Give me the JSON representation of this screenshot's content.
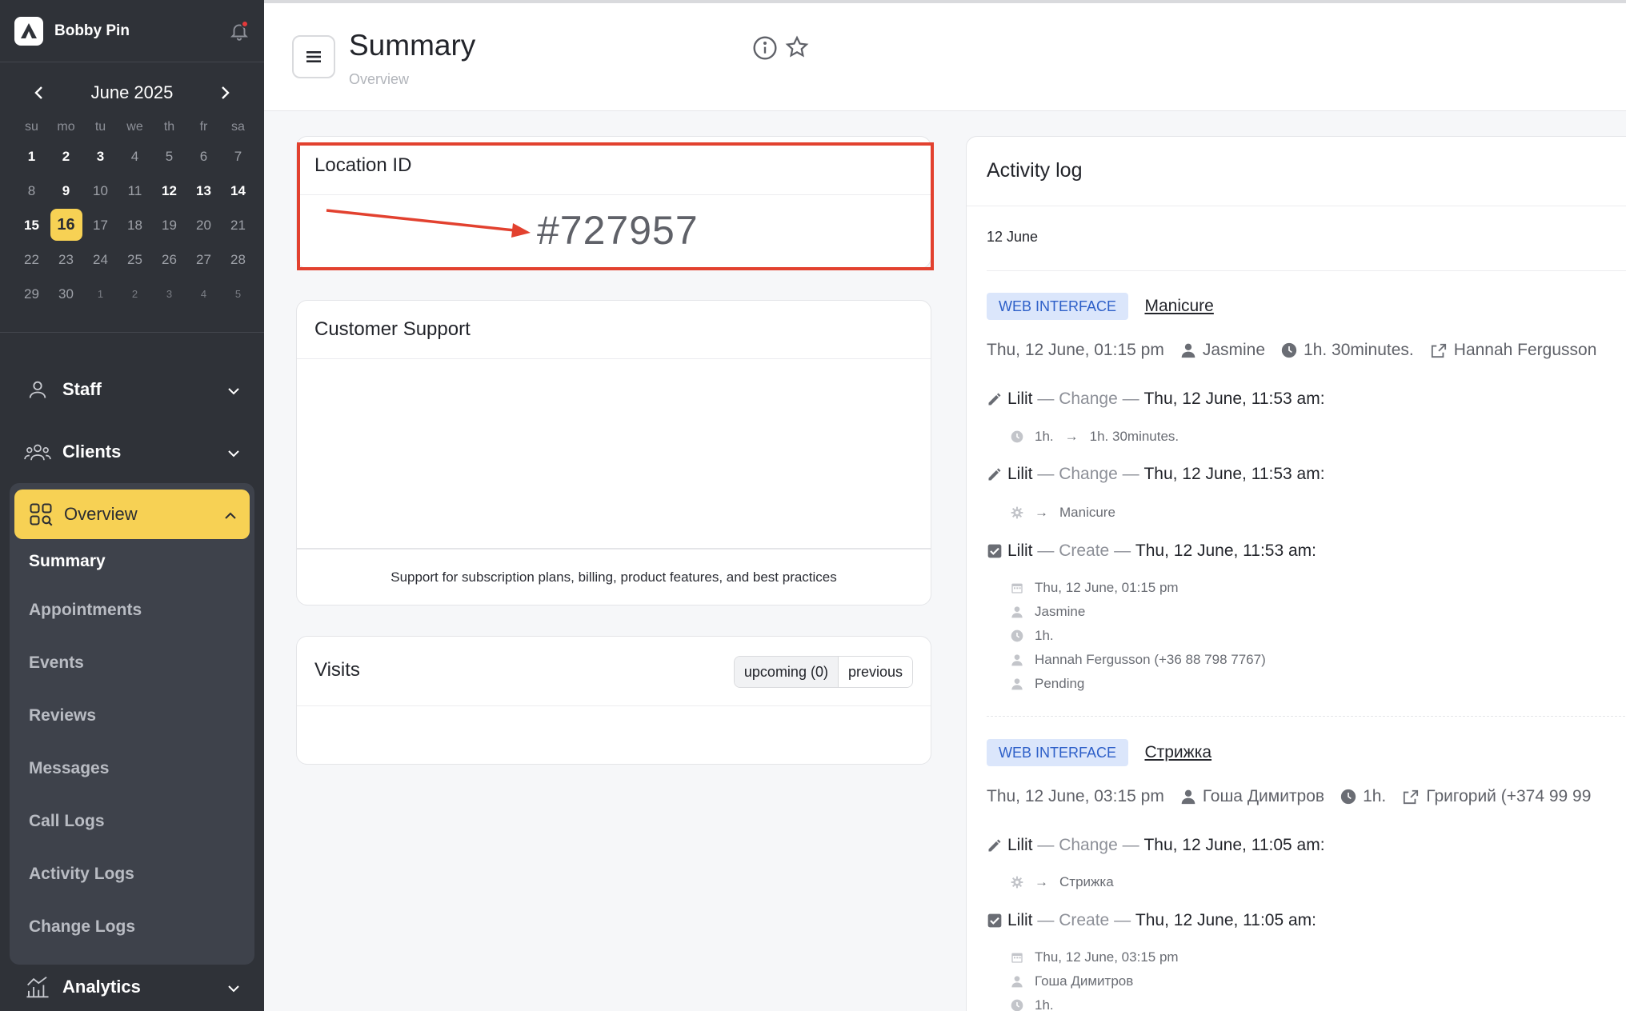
{
  "sidebar": {
    "user_name": "Bobby Pin",
    "calendar": {
      "title": "June 2025",
      "weekdays": [
        "su",
        "mo",
        "tu",
        "we",
        "th",
        "fr",
        "sa"
      ],
      "days": [
        [
          "1",
          "2",
          "3",
          "4",
          "5",
          "6",
          "7"
        ],
        [
          "8",
          "9",
          "10",
          "11",
          "12",
          "13",
          "14"
        ],
        [
          "15",
          "16",
          "17",
          "18",
          "19",
          "20",
          "21"
        ],
        [
          "22",
          "23",
          "24",
          "25",
          "26",
          "27",
          "28"
        ],
        [
          "29",
          "30",
          "1",
          "2",
          "3",
          "4",
          "5"
        ]
      ]
    },
    "nav": {
      "staff": "Staff",
      "clients": "Clients",
      "overview": "Overview",
      "analytics": "Analytics"
    },
    "overview_items": [
      "Summary",
      "Appointments",
      "Events",
      "Reviews",
      "Messages",
      "Call Logs",
      "Activity Logs",
      "Change Logs"
    ]
  },
  "header": {
    "title": "Summary",
    "subtitle": "Overview"
  },
  "location_card": {
    "title": "Location ID",
    "value": "#727957"
  },
  "support_card": {
    "title": "Customer Support",
    "description": "Support for subscription plans, billing, product features, and best practices"
  },
  "visits_card": {
    "title": "Visits",
    "tab_upcoming": "upcoming (0)",
    "tab_previous": "previous"
  },
  "activity_log": {
    "title": "Activity log",
    "date_group": "12 June",
    "entries": [
      {
        "source": "WEB INTERFACE",
        "service": "Manicure",
        "datetime": "Thu, 12 June, 01:15 pm",
        "staff": "Jasmine",
        "duration": "1h. 30minutes.",
        "client": "Hannah Fergusson",
        "changes": [
          {
            "user": "Lilit",
            "action": "Change",
            "when": "Thu, 12 June, 11:53 am:",
            "from": "1h.",
            "to": "1h. 30minutes."
          },
          {
            "user": "Lilit",
            "action": "Change",
            "when": "Thu, 12 June, 11:53 am:",
            "to": "Manicure"
          },
          {
            "user": "Lilit",
            "action": "Create",
            "when": "Thu, 12 June, 11:53 am:",
            "details": [
              "Thu, 12 June, 01:15 pm",
              "Jasmine",
              "1h.",
              "Hannah Fergusson (+36 88 798 7767)",
              "Pending"
            ]
          }
        ]
      },
      {
        "source": "WEB INTERFACE",
        "service": "Стрижка",
        "datetime": "Thu, 12 June, 03:15 pm",
        "staff": "Гоша Димитров",
        "duration": "1h.",
        "client": "Григорий (+374 99 99",
        "changes": [
          {
            "user": "Lilit",
            "action": "Change",
            "when": "Thu, 12 June, 11:05 am:",
            "to": "Стрижка"
          },
          {
            "user": "Lilit",
            "action": "Create",
            "when": "Thu, 12 June, 11:05 am:",
            "details": [
              "Thu, 12 June, 03:15 pm",
              "Гоша Димитров",
              "1h."
            ]
          }
        ]
      }
    ],
    "separator": "—",
    "arrow": "→"
  },
  "colors": {
    "sidebar_bg": "#2f3238",
    "accent_yellow": "#f7d154",
    "badge_bg": "#dbe6fb",
    "badge_text": "#2d5fc8",
    "highlight_red": "#e2412f"
  }
}
